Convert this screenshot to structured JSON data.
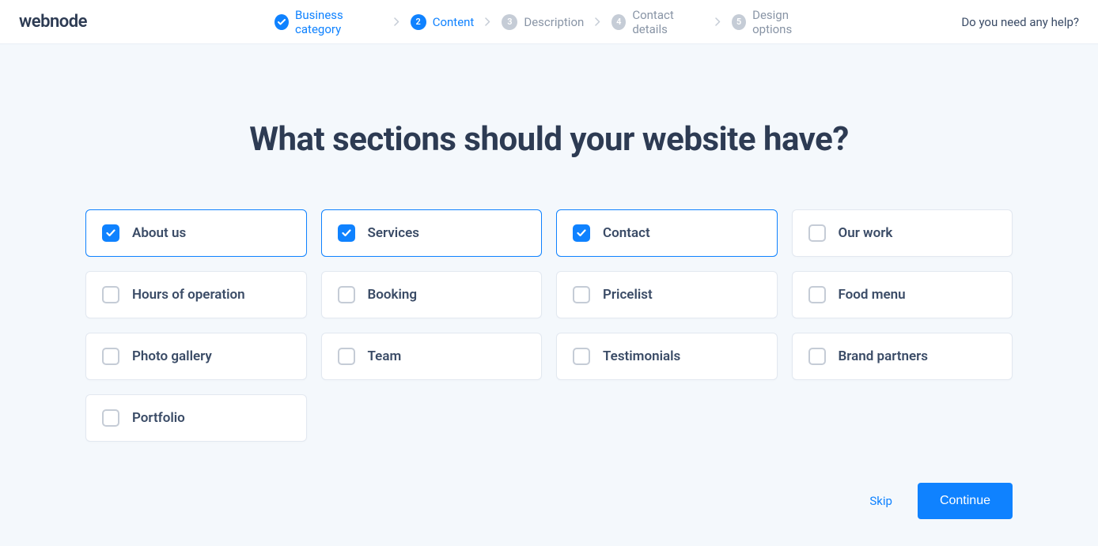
{
  "logo": "webnode",
  "help_link": "Do you need any help?",
  "steps": [
    {
      "num": "✓",
      "label": "Business category",
      "state": "done"
    },
    {
      "num": "2",
      "label": "Content",
      "state": "active"
    },
    {
      "num": "3",
      "label": "Description",
      "state": "pending"
    },
    {
      "num": "4",
      "label": "Contact details",
      "state": "pending"
    },
    {
      "num": "5",
      "label": "Design options",
      "state": "pending"
    }
  ],
  "title": "What sections should your website have?",
  "sections": [
    {
      "label": "About us",
      "selected": true
    },
    {
      "label": "Services",
      "selected": true
    },
    {
      "label": "Contact",
      "selected": true
    },
    {
      "label": "Our work",
      "selected": false
    },
    {
      "label": "Hours of operation",
      "selected": false
    },
    {
      "label": "Booking",
      "selected": false
    },
    {
      "label": "Pricelist",
      "selected": false
    },
    {
      "label": "Food menu",
      "selected": false
    },
    {
      "label": "Photo gallery",
      "selected": false
    },
    {
      "label": "Team",
      "selected": false
    },
    {
      "label": "Testimonials",
      "selected": false
    },
    {
      "label": "Brand partners",
      "selected": false
    },
    {
      "label": "Portfolio",
      "selected": false
    }
  ],
  "footer": {
    "skip": "Skip",
    "continue": "Continue"
  }
}
